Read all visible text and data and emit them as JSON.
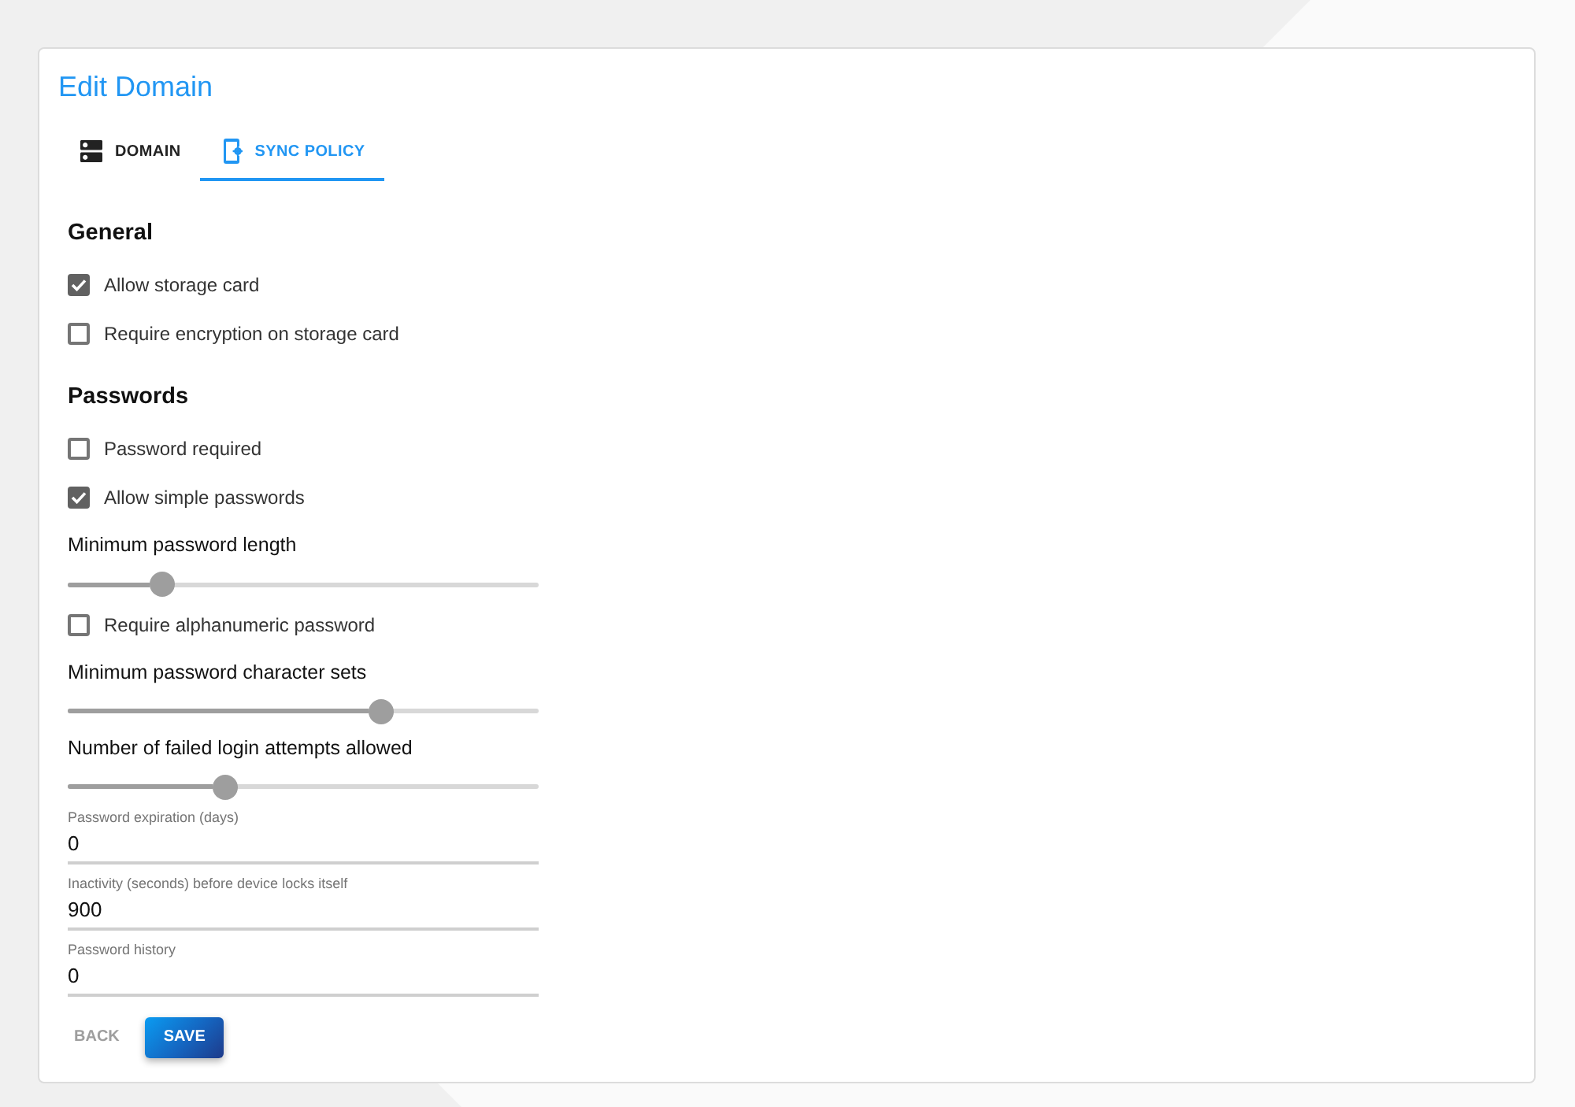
{
  "window": {
    "title": "Edit Domain"
  },
  "tabs": [
    {
      "label": "DOMAIN",
      "selected": false
    },
    {
      "label": "SYNC POLICY",
      "selected": true
    }
  ],
  "sections": [
    {
      "heading": "General",
      "items": [
        {
          "kind": "checkbox",
          "label": "Allow storage card",
          "checked": true
        },
        {
          "kind": "checkbox",
          "label": "Require encryption on storage card",
          "checked": false
        }
      ]
    },
    {
      "heading": "Passwords",
      "items": [
        {
          "kind": "checkbox",
          "label": "Password required",
          "checked": false
        },
        {
          "kind": "checkbox",
          "label": "Allow simple passwords",
          "checked": true
        },
        {
          "kind": "slider",
          "label": "Minimum password length",
          "level": 0.2
        },
        {
          "kind": "checkbox",
          "label": "Require alphanumeric password",
          "checked": false
        },
        {
          "kind": "slider",
          "label": "Minimum password character sets",
          "level": 0.667
        },
        {
          "kind": "slider",
          "label": "Number of failed login attempts allowed",
          "level": 0.333
        },
        {
          "kind": "field",
          "label": "Password expiration (days)",
          "value": "0"
        },
        {
          "kind": "field",
          "label": "Inactivity (seconds) before device locks itself",
          "value": "900"
        },
        {
          "kind": "field",
          "label": "Password history",
          "value": "0"
        }
      ]
    }
  ],
  "buttons": [
    {
      "kind": "text",
      "label": "BACK"
    },
    {
      "kind": "raised",
      "label": "SAVE"
    }
  ]
}
